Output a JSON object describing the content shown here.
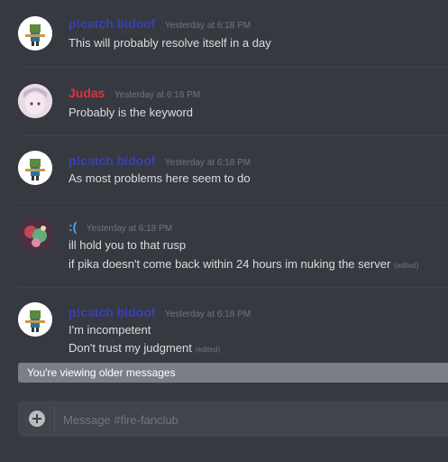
{
  "messages": [
    {
      "username": "p!catch bidoof",
      "username_color": "#3b3fb6",
      "timestamp": "Yesterday at 6:18 PM",
      "lines": [
        "This will probably resolve itself in a day"
      ]
    },
    {
      "username": "Judas",
      "username_color": "#e0313f",
      "timestamp": "Yesterday at 6:18 PM",
      "lines": [
        "Probably is the keyword"
      ]
    },
    {
      "username": "p!catch bidoof",
      "username_color": "#3b3fb6",
      "timestamp": "Yesterday at 6:18 PM",
      "lines": [
        "As most problems here seem to do"
      ]
    },
    {
      "username": ":(",
      "username_color": "#4fa3e8",
      "timestamp": "Yesterday at 6:18 PM",
      "lines": [
        "ill hold you to that rusp",
        "if pika doesn't come back within 24 hours  im nuking the server"
      ],
      "edited": "(edited)"
    },
    {
      "username": "p!catch bidoof",
      "username_color": "#3b3fb6",
      "timestamp": "Yesterday at 6:18 PM",
      "lines": [
        "I'm incompetent",
        "Don't trust my judgment"
      ],
      "edited": "(edited)"
    }
  ],
  "older_messages_bar": "You're viewing older messages",
  "composer": {
    "placeholder": "Message #fire-fanclub"
  },
  "colors": {
    "background": "#36393f",
    "composer_bg": "#40444b",
    "older_bar_bg": "#7a7f87"
  }
}
